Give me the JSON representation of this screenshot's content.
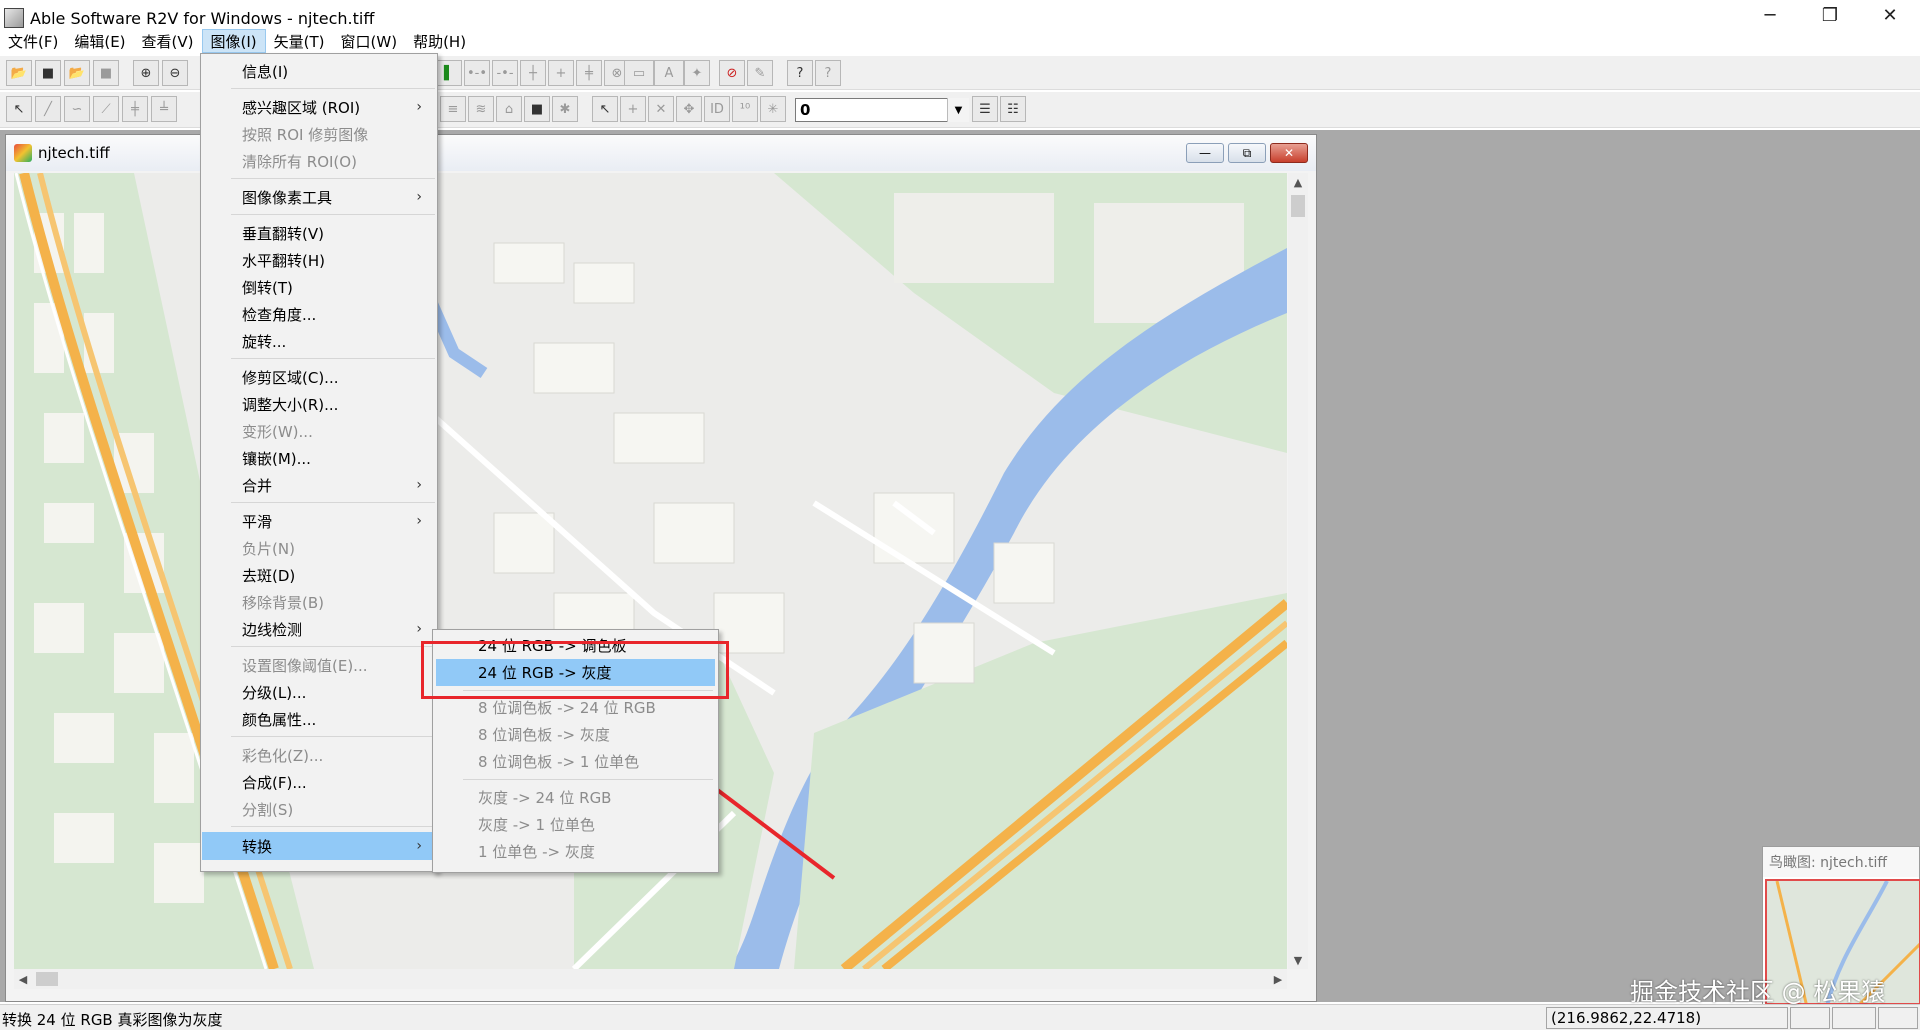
{
  "window": {
    "title": "Able Software R2V for Windows - njtech.tiff",
    "controls": [
      "─",
      "❐",
      "✕"
    ]
  },
  "menubar": [
    "文件(F)",
    "编辑(E)",
    "查看(V)",
    "图像(I)",
    "矢量(T)",
    "窗口(W)",
    "帮助(H)"
  ],
  "toolbar": {
    "layer_value": "0"
  },
  "child": {
    "title": "njtech.tiff",
    "controls": [
      "—",
      "⧉",
      "✕"
    ]
  },
  "image_menu": [
    {
      "label": "信息(I)",
      "enabled": true
    },
    {
      "label": "感兴趣区域 (ROI)",
      "enabled": true,
      "submenu": true
    },
    {
      "label": "按照 ROI 修剪图像",
      "enabled": false
    },
    {
      "label": "清除所有 ROI(O)",
      "enabled": false
    },
    {
      "label": "图像像素工具",
      "enabled": true,
      "submenu": true
    },
    {
      "label": "垂直翻转(V)",
      "enabled": true
    },
    {
      "label": "水平翻转(H)",
      "enabled": true
    },
    {
      "label": "倒转(T)",
      "enabled": true
    },
    {
      "label": "检查角度...",
      "enabled": true
    },
    {
      "label": "旋转...",
      "enabled": true
    },
    {
      "label": "修剪区域(C)...",
      "enabled": true
    },
    {
      "label": "调整大小(R)...",
      "enabled": true
    },
    {
      "label": "变形(W)...",
      "enabled": false
    },
    {
      "label": "镶嵌(M)...",
      "enabled": true
    },
    {
      "label": "合并",
      "enabled": true,
      "submenu": true
    },
    {
      "label": "平滑",
      "enabled": true,
      "submenu": true
    },
    {
      "label": "负片(N)",
      "enabled": false
    },
    {
      "label": "去斑(D)",
      "enabled": true
    },
    {
      "label": "移除背景(B)",
      "enabled": false
    },
    {
      "label": "边线检测",
      "enabled": true,
      "submenu": true
    },
    {
      "label": "设置图像阈值(E)...",
      "enabled": false
    },
    {
      "label": "分级(L)...",
      "enabled": true
    },
    {
      "label": "颜色属性...",
      "enabled": true
    },
    {
      "label": "彩色化(Z)...",
      "enabled": false
    },
    {
      "label": "合成(F)...",
      "enabled": true
    },
    {
      "label": "分割(S)",
      "enabled": false
    },
    {
      "label": "转换",
      "enabled": true,
      "submenu": true,
      "active": true
    }
  ],
  "convert_submenu": [
    {
      "label": "24 位 RGB -> 调色板",
      "enabled": true
    },
    {
      "label": "24 位 RGB -> 灰度",
      "enabled": true,
      "active": true
    },
    {
      "label": "8 位调色板 -> 24 位 RGB",
      "enabled": false
    },
    {
      "label": "8 位调色板 -> 灰度",
      "enabled": false
    },
    {
      "label": "8 位调色板 -> 1 位单色",
      "enabled": false
    },
    {
      "label": "灰度 -> 24 位 RGB",
      "enabled": false
    },
    {
      "label": "灰度 -> 1 位单色",
      "enabled": false
    },
    {
      "label": "1 位单色 -> 灰度",
      "enabled": false
    }
  ],
  "overview": {
    "title": "鸟瞰图: njtech.tiff"
  },
  "status": {
    "message": "转换 24 位 RGB 真彩图像为灰度",
    "coords": "(216.9862,22.4718)"
  },
  "watermark": "掘金技术社区 @ 松果猿",
  "colors": {
    "highlight": "#91c9f7",
    "annotation": "#e8262b",
    "water": "#9bbcea",
    "green": "#cfe6cc",
    "road_orange": "#f4b24a"
  }
}
